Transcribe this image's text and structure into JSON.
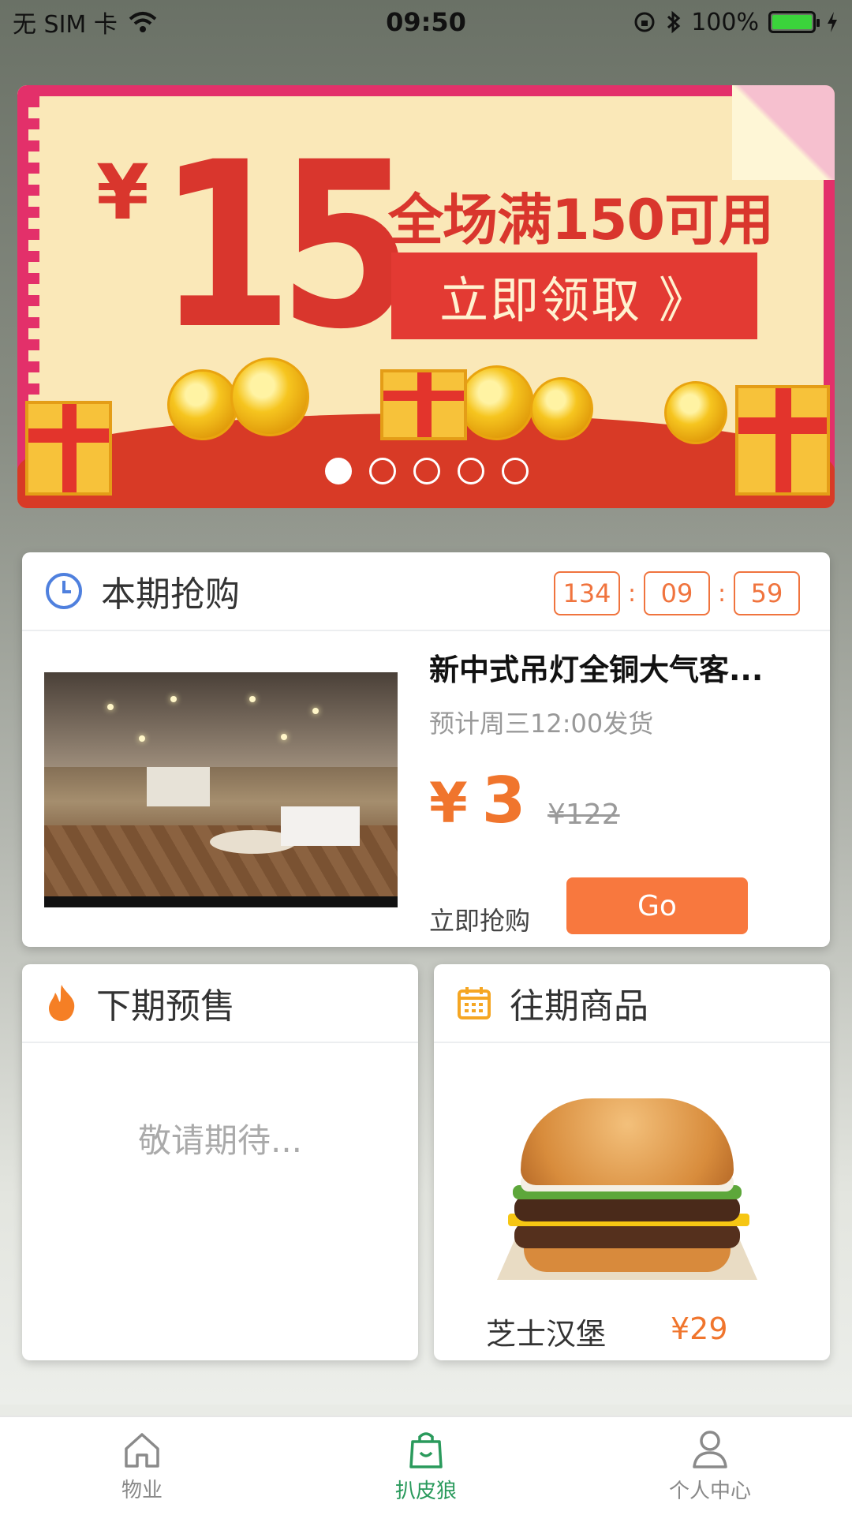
{
  "status_bar": {
    "carrier": "无 SIM 卡",
    "time": "09:50",
    "battery": "100%"
  },
  "banner": {
    "currency": "¥",
    "amount": "15",
    "headline": "全场满150可用",
    "cta": "立即领取 》",
    "page_count": 5,
    "active_page": 1
  },
  "flash_sale": {
    "title": "本期抢购",
    "timer": {
      "hours": "134",
      "minutes": "09",
      "seconds": "59"
    },
    "product": {
      "name": "新中式吊灯全铜大气客...",
      "shipping": "预计周三12:00发货",
      "currency": "¥",
      "price": "3",
      "original_price": "¥122",
      "buy_label": "立即抢购",
      "go_label": "Go"
    }
  },
  "presale": {
    "title": "下期预售",
    "placeholder": "敬请期待..."
  },
  "past_items": {
    "title": "往期商品",
    "item_name": "芝士汉堡",
    "item_price": "¥29"
  },
  "tabbar": {
    "tabs": [
      {
        "label": "物业",
        "icon": "home-icon",
        "active": false
      },
      {
        "label": "扒皮狼",
        "icon": "shopping-bag-icon",
        "active": true
      },
      {
        "label": "个人中心",
        "icon": "person-icon",
        "active": false
      }
    ]
  },
  "colors": {
    "accent_orange": "#f0752d",
    "tab_active_green": "#2a9a5c",
    "banner_red": "#d9362d"
  }
}
